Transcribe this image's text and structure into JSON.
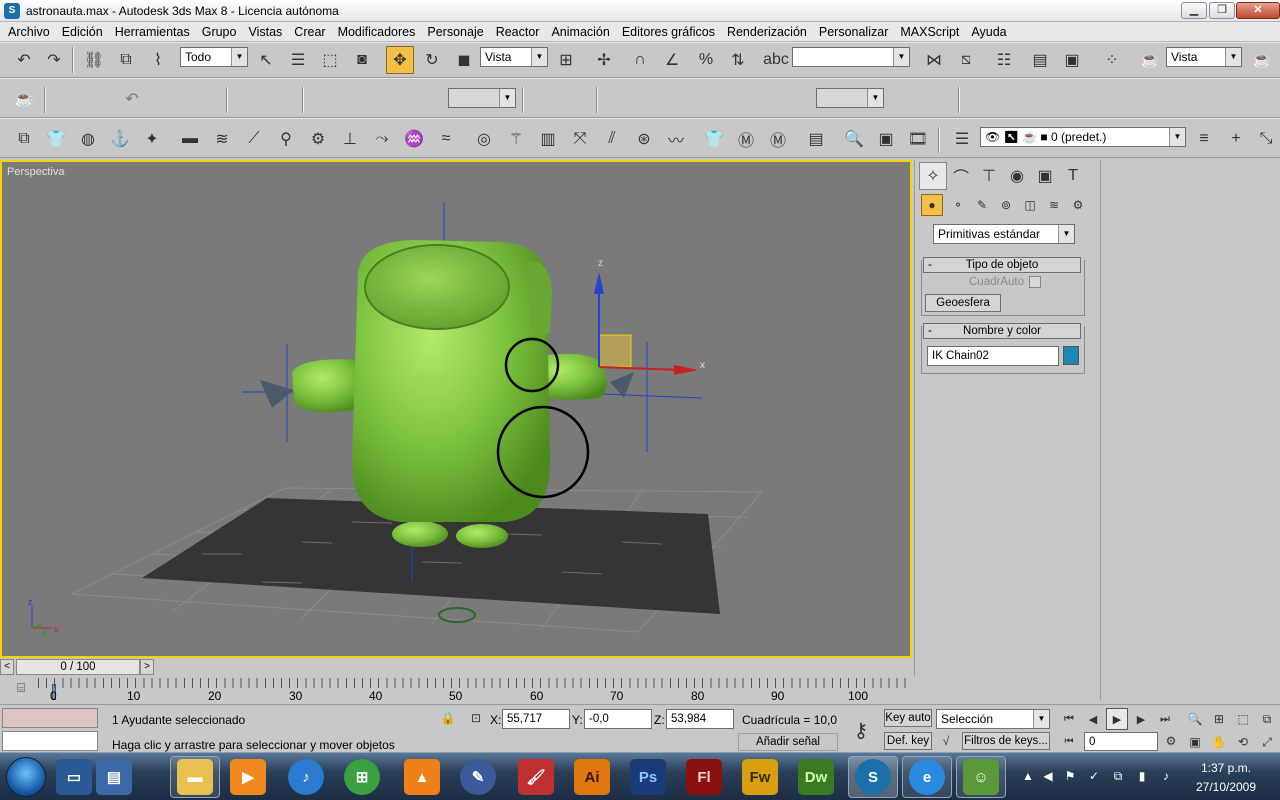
{
  "window": {
    "title": "astronauta.max - Autodesk 3ds Max 8  - Licencia autónoma",
    "app_icon": "3dsmax-icon",
    "minimize": "▁",
    "maximize": "❐",
    "close": "✕"
  },
  "menu": [
    "Archivo",
    "Edición",
    "Herramientas",
    "Grupo",
    "Vistas",
    "Crear",
    "Modificadores",
    "Personaje",
    "Reactor",
    "Animación",
    "Editores gráficos",
    "Renderización",
    "Personalizar",
    "MAXScript",
    "Ayuda"
  ],
  "main_toolbar": {
    "selection_filter": "Todo",
    "reference_coord": "Vista",
    "named_selection": "",
    "render_view": "Vista"
  },
  "layers_toolbar": {
    "current_layer": "0 (predet.)"
  },
  "viewport": {
    "label": "Perspectiva",
    "axis_labels": {
      "x": "x",
      "y": "y",
      "z": "z"
    },
    "gizmo_labels": {
      "x": "x",
      "z": "z"
    }
  },
  "command_panel": {
    "category": "Primitivas estándar",
    "rollout_object_type": {
      "title": "Tipo de objeto",
      "autogrid_label": "CuadrAuto",
      "button": "Geoesfera"
    },
    "rollout_name_color": {
      "title": "Nombre y color",
      "object_name": "IK Chain02",
      "color": "#1a8ab4"
    },
    "minus": "-"
  },
  "time_slider": {
    "frame": "0 / 100",
    "prev": "<",
    "next": ">"
  },
  "track": {
    "ticks": [
      "0",
      "10",
      "20",
      "30",
      "40",
      "50",
      "60",
      "70",
      "80",
      "90",
      "100"
    ]
  },
  "status": {
    "selection_info": "1 Ayudante seleccionado",
    "prompt": "Haga clic y arrastre para seleccionar y mover objetos",
    "x_label": "X:",
    "x_value": "55,717",
    "y_label": "Y:",
    "y_value": "-0,0",
    "z_label": "Z:",
    "z_value": "53,984",
    "grid": "Cuadrícula = 10,0",
    "add_time_tag": "Añadir señal tiempo",
    "key_auto": "Key auto",
    "set_key": "Def. key",
    "selection_set": "Selección",
    "key_filters": "Filtros de keys...",
    "current_frame": "0"
  },
  "taskbar": {
    "apps": [
      "Ai",
      "Ps",
      "Fl",
      "Fw",
      "Dw"
    ],
    "time": "1:37 p.m.",
    "date": "27/10/2009"
  },
  "colors": {
    "model_green": "#7cc23e",
    "viewport_bg": "#7a7a7a",
    "active_border": "#f4d400",
    "ui_gray": "#c8c8c8"
  }
}
